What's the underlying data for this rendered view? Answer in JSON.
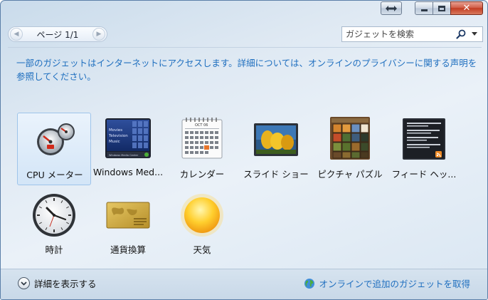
{
  "window": {
    "swap_icon": "swap-arrows-icon",
    "minimize_icon": "minimize-icon",
    "maximize_icon": "maximize-icon",
    "close_icon": "close-icon"
  },
  "toolbar": {
    "page_indicator": "ページ 1/1",
    "prev_icon": "chevron-left-icon",
    "next_icon": "chevron-right-icon",
    "search_placeholder": "ガジェットを検索",
    "search_icon": "search-icon",
    "dropdown_icon": "chevron-down-icon"
  },
  "description": "一部のガジェットはインターネットにアクセスします。詳細については、オンラインのプライバシーに関する声明を参照してください。",
  "gadgets": [
    {
      "label": "CPU メーター",
      "icon": "cpu-meter-icon",
      "selected": true
    },
    {
      "label": "Windows Med...",
      "icon": "windows-media-center-icon",
      "selected": false
    },
    {
      "label": "カレンダー",
      "icon": "calendar-icon",
      "selected": false
    },
    {
      "label": "スライド ショー",
      "icon": "slideshow-icon",
      "selected": false
    },
    {
      "label": "ピクチャ パズル",
      "icon": "picture-puzzle-icon",
      "selected": false
    },
    {
      "label": "フィード ヘッ...",
      "icon": "feed-headlines-icon",
      "selected": false
    },
    {
      "label": "時計",
      "icon": "clock-icon",
      "selected": false
    },
    {
      "label": "通貨換算",
      "icon": "currency-icon",
      "selected": false
    },
    {
      "label": "天気",
      "icon": "weather-sun-icon",
      "selected": false
    }
  ],
  "wmc_text": {
    "line1": "Movies",
    "line2": "Television",
    "line3": "Music",
    "bar": "Windows Media Center"
  },
  "calendar_text": {
    "month": "OCT 06"
  },
  "footer": {
    "show_details": "詳細を表示する",
    "show_details_icon": "chevron-down-icon",
    "get_more_online": "オンラインで追加のガジェットを取得",
    "globe_icon": "globe-icon"
  },
  "colors": {
    "link": "#1f6fbf",
    "close_button": "#c23d22",
    "selection_border": "#9ec4ea"
  }
}
